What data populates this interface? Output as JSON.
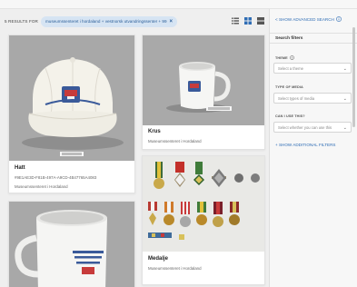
{
  "results": {
    "count_label": "5 RESULTS FOR",
    "query": "museumssenteret i hordaland + vestnorsk utvandringssenter + 99"
  },
  "cards": [
    {
      "title": "Hatt",
      "id": "#9E1AE3D-F81B-497A-A9CD-4B47765A4083",
      "owner": "Museumssenteret i Hordaland"
    },
    {
      "title": "Krus",
      "owner": "Museumssenteret i Hordaland"
    },
    {
      "title": "Medalje",
      "owner": "Museumssenteret i Hordaland"
    },
    {
      "title": "",
      "owner": ""
    }
  ],
  "sidebar": {
    "advanced_search": "< SHOW ADVANCED SEARCH",
    "search_filters": "Search filters",
    "theme_label": "THEME",
    "theme_placeholder": "Select a theme",
    "media_label": "TYPE OF MEDIA",
    "media_placeholder": "Select types of media",
    "use_label": "CAN I USE THIS?",
    "use_placeholder": "Select whether you can use this",
    "show_more_filters": "+ SHOW ADDITIONAL FILTERS"
  },
  "icons": {
    "list_view": "list-icon",
    "grid_view": "grid-icon",
    "large_view": "large-grid-icon",
    "info": "info-icon"
  },
  "colors": {
    "link": "#2f6db5",
    "chip_bg": "#d6e4f3",
    "active_view": "#2f6db5"
  }
}
